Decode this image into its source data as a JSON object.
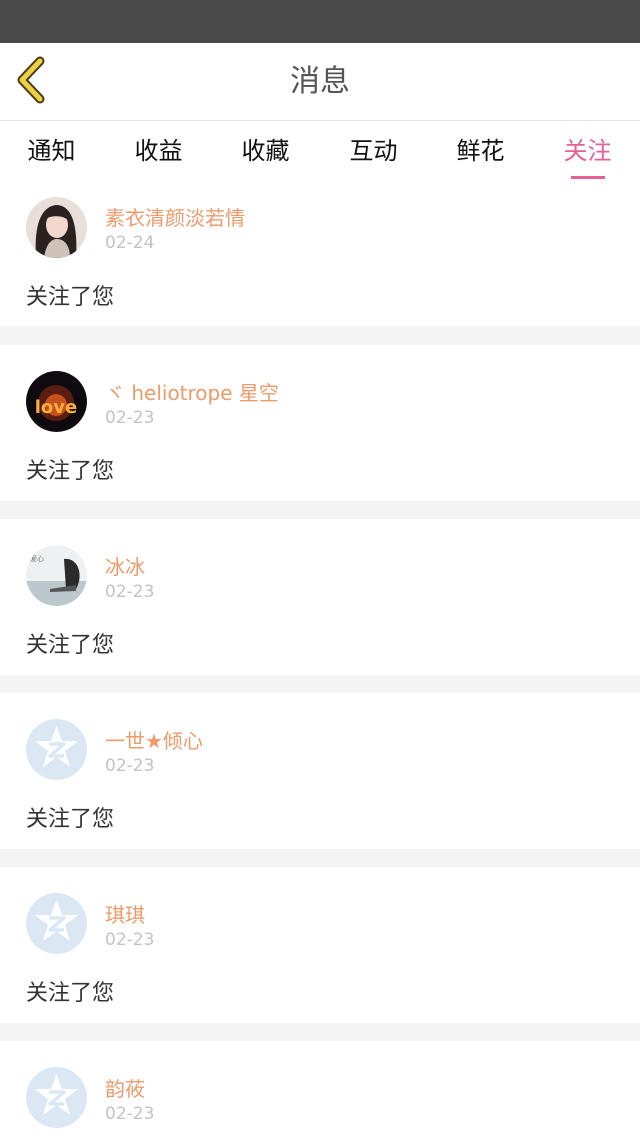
{
  "header": {
    "title": "消息",
    "back_icon": "chevron-left-icon"
  },
  "tabs": [
    {
      "label": "通知",
      "active": false
    },
    {
      "label": "收益",
      "active": false
    },
    {
      "label": "收藏",
      "active": false
    },
    {
      "label": "互动",
      "active": false
    },
    {
      "label": "鲜花",
      "active": false
    },
    {
      "label": "关注",
      "active": true
    }
  ],
  "colors": {
    "accent": "#e95e95",
    "username": "#ee9a6a",
    "back_icon": "#e0c23a",
    "default_avatar": "#dbe8f4"
  },
  "follows": [
    {
      "name": "素衣清颜淡若情",
      "date": "02-24",
      "message": "关注了您",
      "avatar": "girl-photo-avatar"
    },
    {
      "name": "ヾ heliotrope 星空",
      "date": "02-23",
      "message": "关注了您",
      "avatar": "love-fire-avatar"
    },
    {
      "name": "冰冰",
      "date": "02-23",
      "message": "关注了您",
      "avatar": "seaside-photo-avatar"
    },
    {
      "name": "一世★倾心",
      "date": "02-23",
      "message": "关注了您",
      "avatar": "default-qq-avatar"
    },
    {
      "name": "琪琪",
      "date": "02-23",
      "message": "关注了您",
      "avatar": "default-qq-avatar"
    },
    {
      "name": "韵莜",
      "date": "02-23",
      "message": "",
      "avatar": "default-qq-avatar"
    }
  ]
}
